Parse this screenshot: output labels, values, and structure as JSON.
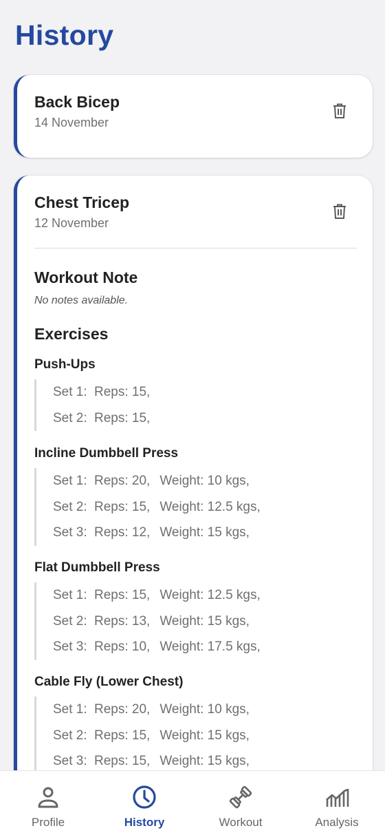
{
  "page": {
    "title": "History"
  },
  "history": [
    {
      "title": "Back Bicep",
      "date": "14 November"
    },
    {
      "title": "Chest Tricep",
      "date": "12 November",
      "note_heading": "Workout Note",
      "note_text": "No notes available.",
      "exercises_heading": "Exercises",
      "exercises": [
        {
          "name": "Push-Ups",
          "sets": [
            {
              "label": "Set 1:",
              "reps": "Reps: 15,",
              "weight": ""
            },
            {
              "label": "Set 2:",
              "reps": "Reps: 15,",
              "weight": ""
            }
          ]
        },
        {
          "name": "Incline Dumbbell Press",
          "sets": [
            {
              "label": "Set 1:",
              "reps": "Reps: 20,",
              "weight": "Weight: 10 kgs,"
            },
            {
              "label": "Set 2:",
              "reps": "Reps: 15,",
              "weight": "Weight: 12.5 kgs,"
            },
            {
              "label": "Set 3:",
              "reps": "Reps: 12,",
              "weight": "Weight: 15 kgs,"
            }
          ]
        },
        {
          "name": "Flat Dumbbell Press",
          "sets": [
            {
              "label": "Set 1:",
              "reps": "Reps: 15,",
              "weight": "Weight: 12.5 kgs,"
            },
            {
              "label": "Set 2:",
              "reps": "Reps: 13,",
              "weight": "Weight: 15 kgs,"
            },
            {
              "label": "Set 3:",
              "reps": "Reps: 10,",
              "weight": "Weight: 17.5 kgs,"
            }
          ]
        },
        {
          "name": "Cable Fly (Lower Chest)",
          "sets": [
            {
              "label": "Set 1:",
              "reps": "Reps: 20,",
              "weight": "Weight: 10 kgs,"
            },
            {
              "label": "Set 2:",
              "reps": "Reps: 15,",
              "weight": "Weight: 15 kgs,"
            },
            {
              "label": "Set 3:",
              "reps": "Reps: 15,",
              "weight": "Weight: 15 kgs,"
            }
          ]
        }
      ]
    }
  ],
  "icons": {
    "delete": "trash-icon"
  },
  "nav": [
    {
      "label": "Profile",
      "icon": "person-icon",
      "active": false
    },
    {
      "label": "History",
      "icon": "clock-icon",
      "active": true
    },
    {
      "label": "Workout",
      "icon": "dumbbell-icon",
      "active": false
    },
    {
      "label": "Analysis",
      "icon": "chart-icon",
      "active": false
    }
  ],
  "colors": {
    "accent": "#2549a0",
    "background": "#f2f2f4",
    "card": "#ffffff",
    "muted_text": "#6f6f6f"
  }
}
